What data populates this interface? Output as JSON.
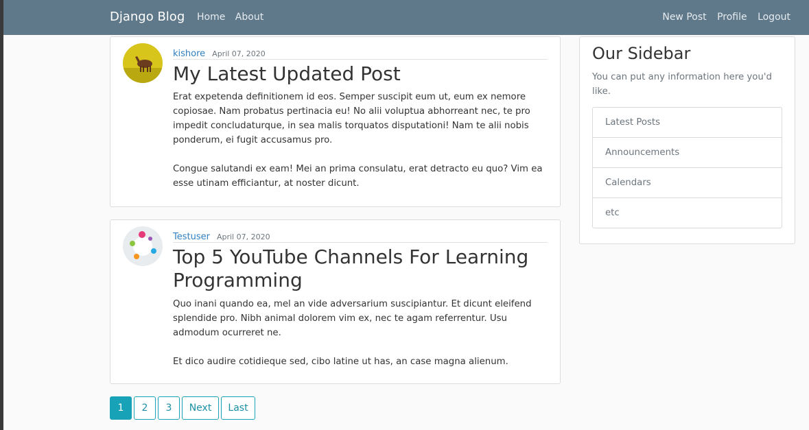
{
  "nav": {
    "brand": "Django Blog",
    "left_links": [
      "Home",
      "About"
    ],
    "right_links": [
      "New Post",
      "Profile",
      "Logout"
    ]
  },
  "posts": [
    {
      "author": "kishore",
      "date": "April 07, 2020",
      "title": "My Latest Updated Post",
      "paragraphs": [
        "Erat expetenda definitionem id eos. Semper suscipit eum ut, eum ex nemore copiosae. Nam probatus pertinacia eu! No alii voluptua abhorreant nec, te pro impedit concludaturque, in sea malis torquatos disputationi! Nam te alii nobis ponderum, ei fugit accusamus pro.",
        "Congue salutandi ex eam! Mei an prima consulatu, erat detracto eu quo? Vim ea esse utinam efficiantur, at noster dicunt."
      ],
      "avatar_icon": "horse-photo-avatar"
    },
    {
      "author": "Testuser",
      "date": "April 07, 2020",
      "title": "Top 5 YouTube Channels For Learning Programming",
      "paragraphs": [
        "Quo inani quando ea, mel an vide adversarium suscipiantur. Et dicunt eleifend splendide pro. Nibh animal dolorem vim ex, nec te agam referrentur. Usu admodum ocurreret ne.",
        "Et dico audire cotidieque sed, cibo latine ut has, an case magna alienum."
      ],
      "avatar_icon": "colorful-circles-avatar"
    }
  ],
  "sidebar": {
    "title": "Our Sidebar",
    "text": "You can put any information here you'd like.",
    "items": [
      "Latest Posts",
      "Announcements",
      "Calendars",
      "etc"
    ]
  },
  "pagination": {
    "pages": [
      "1",
      "2",
      "3"
    ],
    "current": "1",
    "next_label": "Next",
    "last_label": "Last"
  },
  "colors": {
    "navbar": "#5f788a",
    "link": "#2f7fc1",
    "pagination_accent": "#18a2b8"
  }
}
